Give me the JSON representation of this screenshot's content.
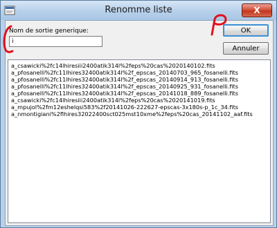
{
  "window": {
    "title": "Renomme liste",
    "close_glyph": "X"
  },
  "form": {
    "output_label": "Nom de sortie generique:",
    "output_value": "i"
  },
  "buttons": {
    "ok": "OK",
    "cancel": "Annuler"
  },
  "files": [
    "a_csawicki%2fc14lhiresiii2400atik314l%2feps%20cas%2020140102.fits",
    "a_pfosanelli%2fc11lhires32400atik314l%2f_epscas_20140703_965_fosanelli.fits",
    "a_pfosanelli%2fc11lhires32400atik314l%2f_epscas_20140914_913_fosanelli.fits",
    "a_pfosanelli%2fc11lhires32400atik314l%2f_epscas_20140925_931_fosanelli.fits",
    "a_pfosanelli%2fc11lhires32400atik314l%2f_epscas_20141018_889_fosanelli.fits",
    "a_csawicki%2fc14lhiresiii2400atik314l%2feps%20cas%2020141019.fits",
    "a_mpujol%2fm12eshelqsi583%2f20141026-222627-epscas-3x180s-p_1c_34.fits",
    "a_nmontigiani%2flhires32022400sct025mst10xme%2feps%20cas_20141102_aaf.fits"
  ],
  "annotation_color": "#e0101c"
}
